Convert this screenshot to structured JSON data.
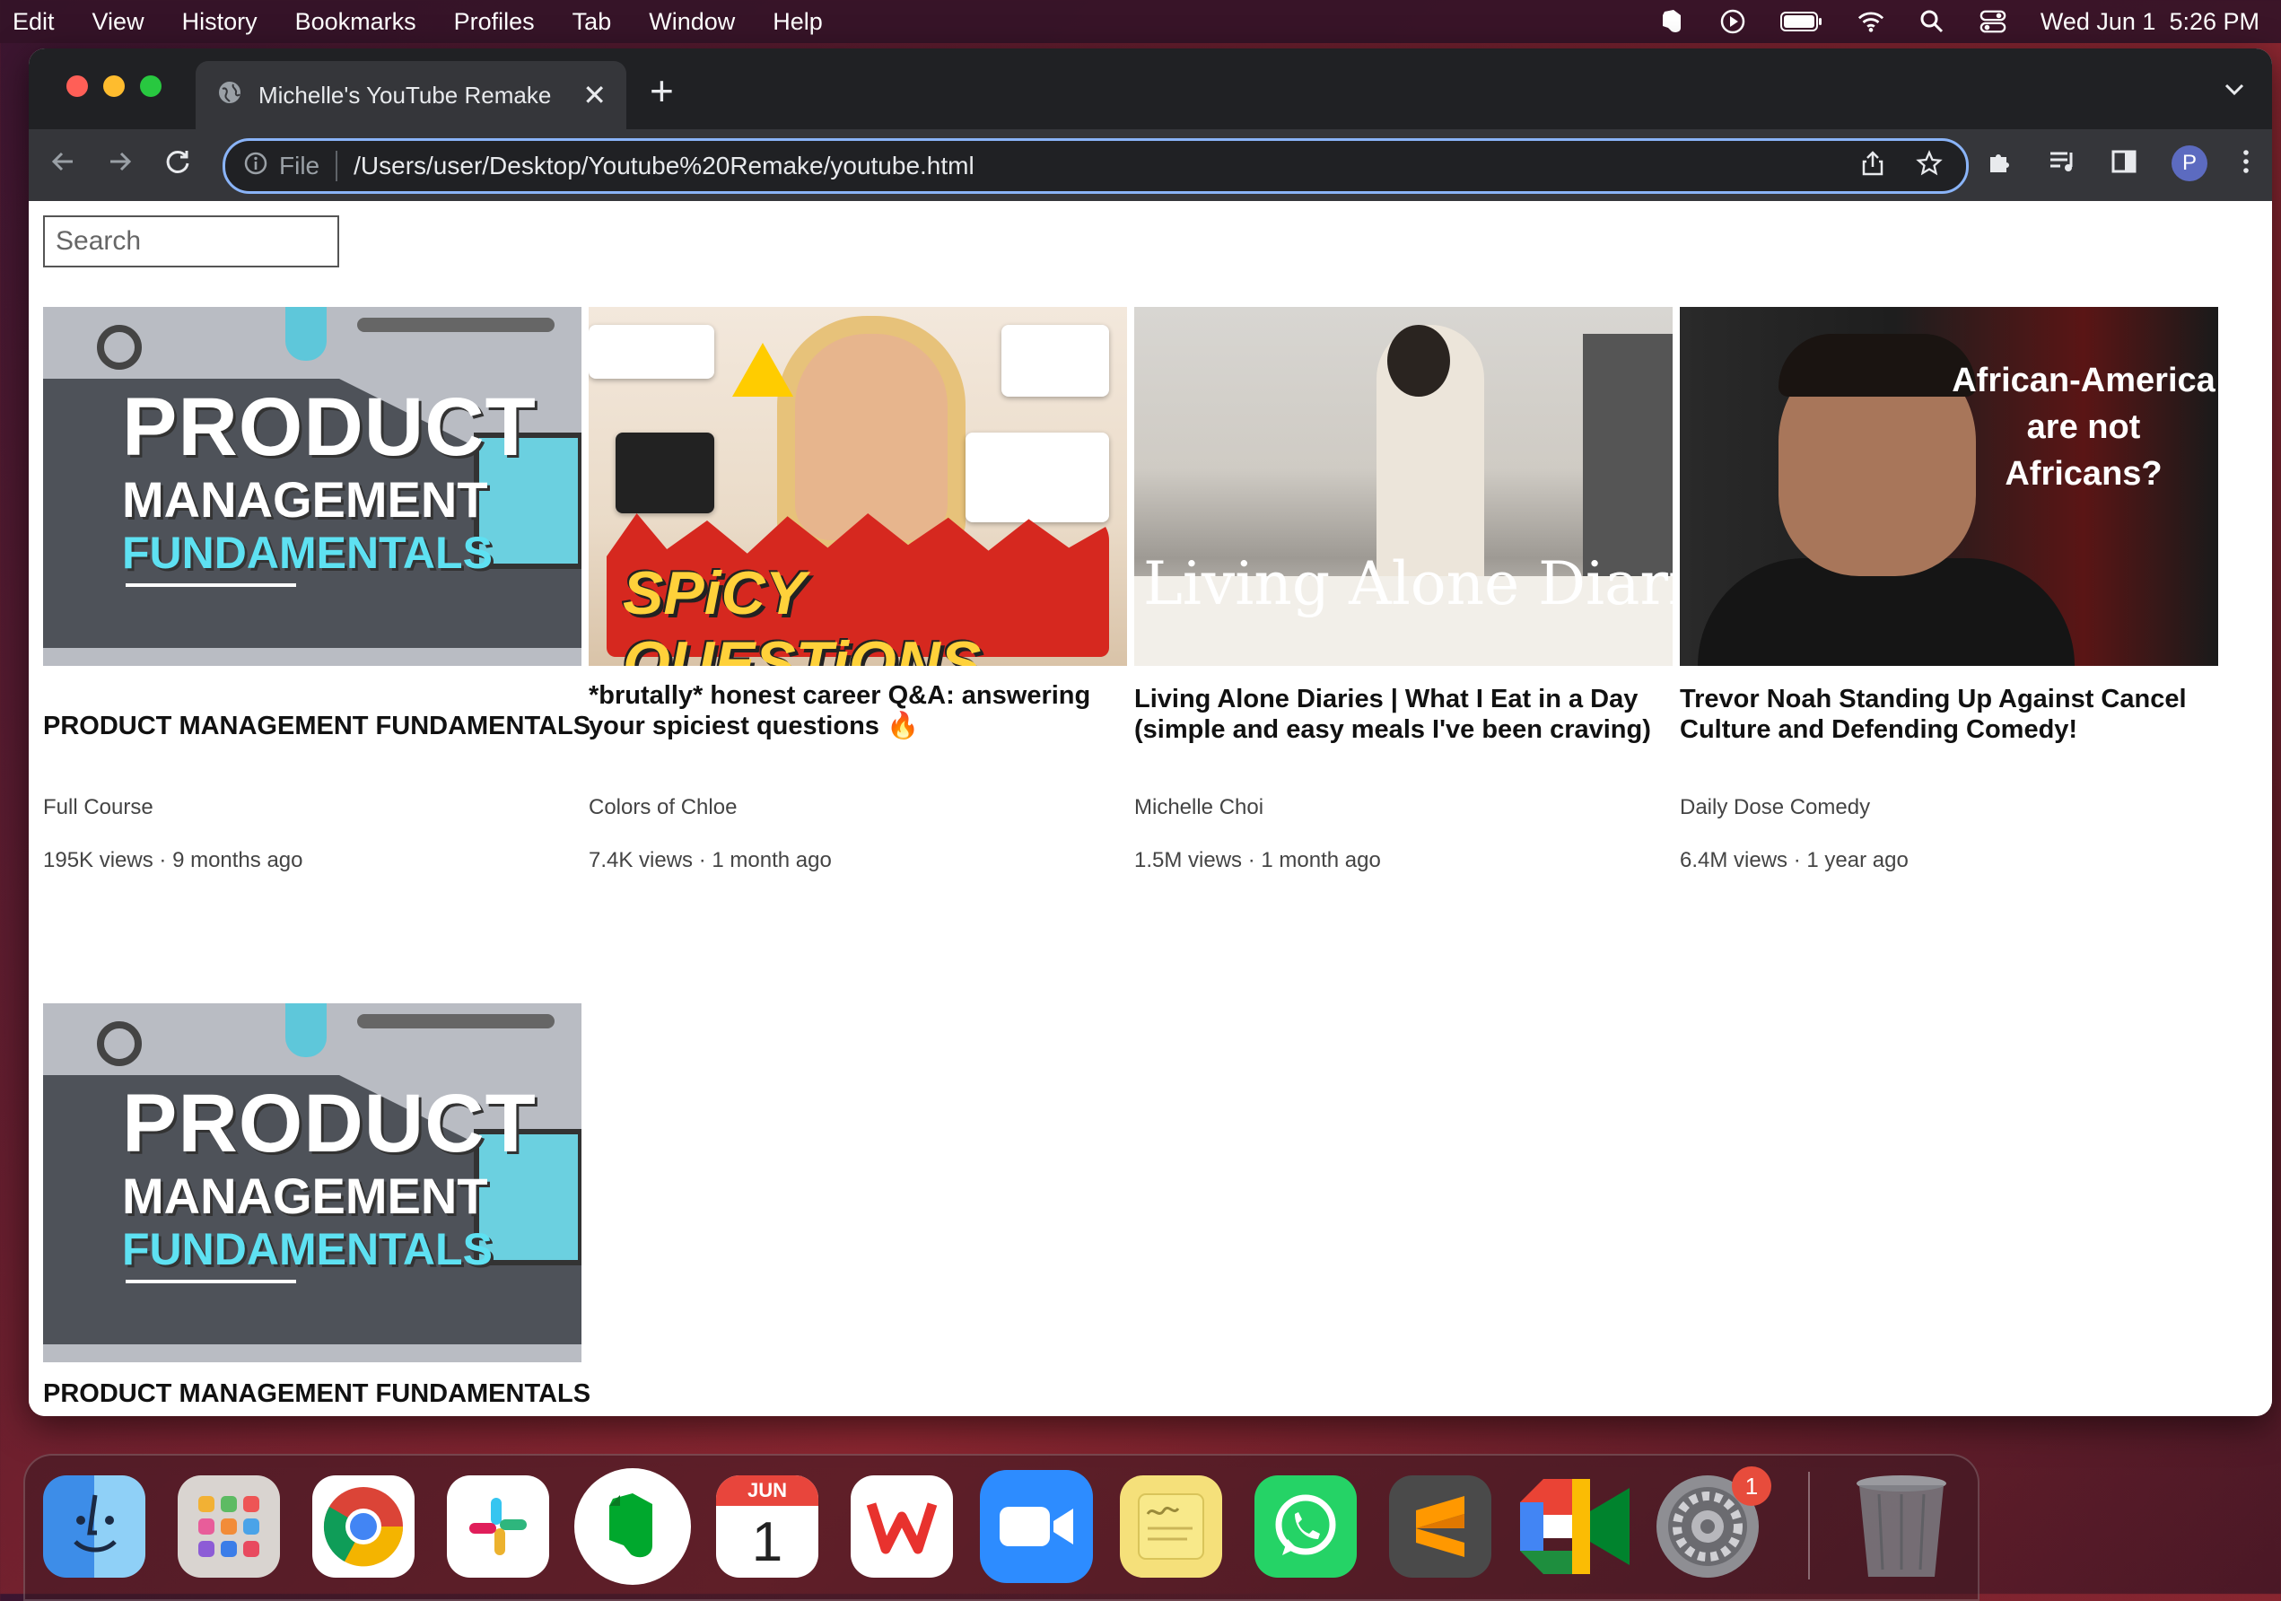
{
  "menubar": {
    "items": [
      "Edit",
      "View",
      "History",
      "Bookmarks",
      "Profiles",
      "Tab",
      "Window",
      "Help"
    ],
    "clock": "Wed Jun 1  5:26 PM"
  },
  "browser": {
    "tab_title": "Michelle's YouTube Remake",
    "omnibox_scheme": "File",
    "url": "/Users/user/Desktop/Youtube%20Remake/youtube.html",
    "profile_initial": "P"
  },
  "page": {
    "search_placeholder": "Search",
    "videos": [
      {
        "title": "PRODUCT MANAGEMENT FUNDAMENTALS",
        "channel": "Full Course",
        "views": "195K views",
        "age": "9 months ago",
        "thumb_text": [
          "PRODUCT",
          "MANAGEMENT",
          "FUNDAMENTALS"
        ]
      },
      {
        "title": "*brutally* honest career Q&A: answering your spiciest questions 🔥",
        "channel": "Colors of Chloe",
        "views": "7.4K views",
        "age": "1 month ago",
        "thumb_text": [
          "SPiCY QUESTiONS"
        ]
      },
      {
        "title": "Living Alone Diaries | What I Eat in a Day (simple and easy meals I've been craving)",
        "channel": "Michelle Choi",
        "views": "1.5M views",
        "age": "1 month ago",
        "thumb_text": [
          "Living Alone Diaries"
        ]
      },
      {
        "title": "Trevor Noah Standing Up Against Cancel Culture and Defending Comedy!",
        "channel": "Daily Dose Comedy",
        "views": "6.4M views",
        "age": "1 year ago",
        "thumb_text": [
          "African-America",
          "are not",
          "Africans?"
        ]
      },
      {
        "title": "PRODUCT MANAGEMENT FUNDAMENTALS",
        "thumb_text": [
          "PRODUCT",
          "MANAGEMENT",
          "FUNDAMENTALS"
        ]
      }
    ],
    "meta_separator": " · "
  },
  "dock": {
    "calendar_month": "JUN",
    "calendar_day": "1",
    "settings_badge": "1",
    "apps": [
      "finder",
      "launchpad",
      "chrome",
      "slack",
      "evernote",
      "calendar",
      "wps-office",
      "zoom",
      "stickies",
      "whatsapp",
      "sublime-text",
      "google-meet",
      "system-preferences",
      "trash"
    ]
  }
}
